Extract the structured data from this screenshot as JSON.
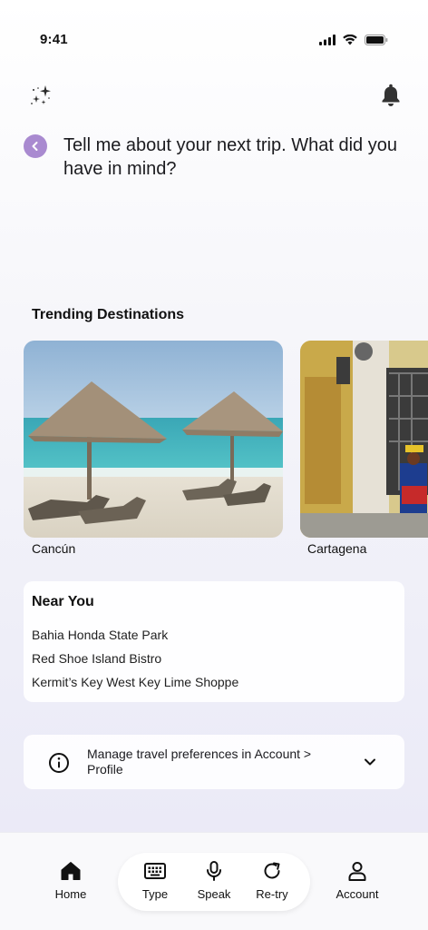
{
  "status": {
    "time": "9:41"
  },
  "header": {
    "sparkle_icon": "sparkle-icon",
    "bell_icon": "bell-icon"
  },
  "prompt": {
    "text": "Tell me about your next trip. What did you have in mind?"
  },
  "trending": {
    "title": "Trending Destinations",
    "cards": [
      {
        "label": "Cancún"
      },
      {
        "label": "Cartagena"
      }
    ]
  },
  "near_you": {
    "title": "Near You",
    "items": [
      "Bahia Honda State Park",
      "Red Shoe Island Bistro",
      "Kermit’s Key West Key Lime Shoppe"
    ]
  },
  "preferences": {
    "text": "Manage travel preferences in Account > Profile"
  },
  "nav": {
    "home": "Home",
    "type": "Type",
    "speak": "Speak",
    "retry": "Re-try",
    "account": "Account"
  },
  "colors": {
    "accent": "#a98ad0",
    "text": "#1b1b1f"
  }
}
